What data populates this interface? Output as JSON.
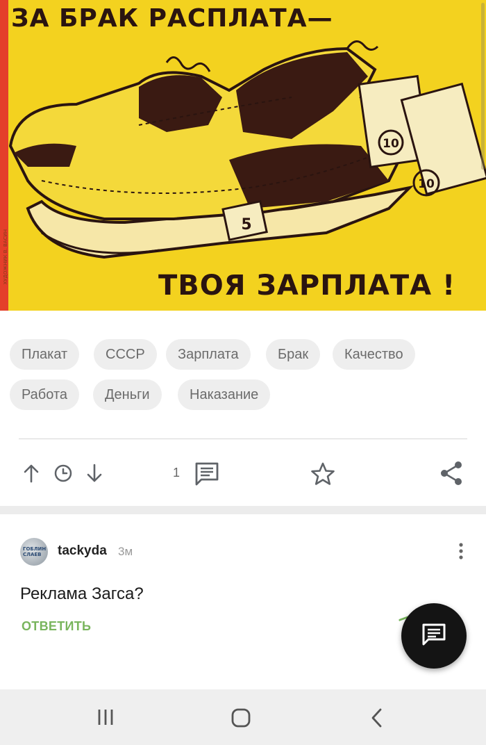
{
  "poster": {
    "headline_top": "ЗА БРАК РАСПЛАТА—",
    "headline_bottom": "ТВОЯ ЗАРПЛАТА !",
    "credit": "ХУДОЖНИК В. ВАСИН",
    "bill_values": [
      "10",
      "10",
      "5"
    ],
    "colors": {
      "background": "#f3d21f",
      "ink": "#2a1410",
      "stripe": "#e43f2a"
    }
  },
  "tags": [
    "Плакат",
    "СССР",
    "Зарплата",
    "Брак",
    "Качество",
    "Работа",
    "Деньги",
    "Наказание"
  ],
  "actions": {
    "comment_count": "1",
    "icons": [
      "arrow-up-icon",
      "clock-icon",
      "arrow-down-icon",
      "comment-icon",
      "star-icon",
      "share-icon"
    ]
  },
  "comment": {
    "author": "tackyda",
    "time": "3м",
    "avatar_text": "ГОБЛИН СЛАЕВ",
    "text": "Реклама Загса?",
    "reply_label": "ОТВЕТИТЬ",
    "accent": "#79b55d"
  },
  "fab": {
    "icon": "comment-icon"
  },
  "navbar": {
    "icons": [
      "recent-apps-icon",
      "home-icon",
      "back-icon"
    ]
  }
}
